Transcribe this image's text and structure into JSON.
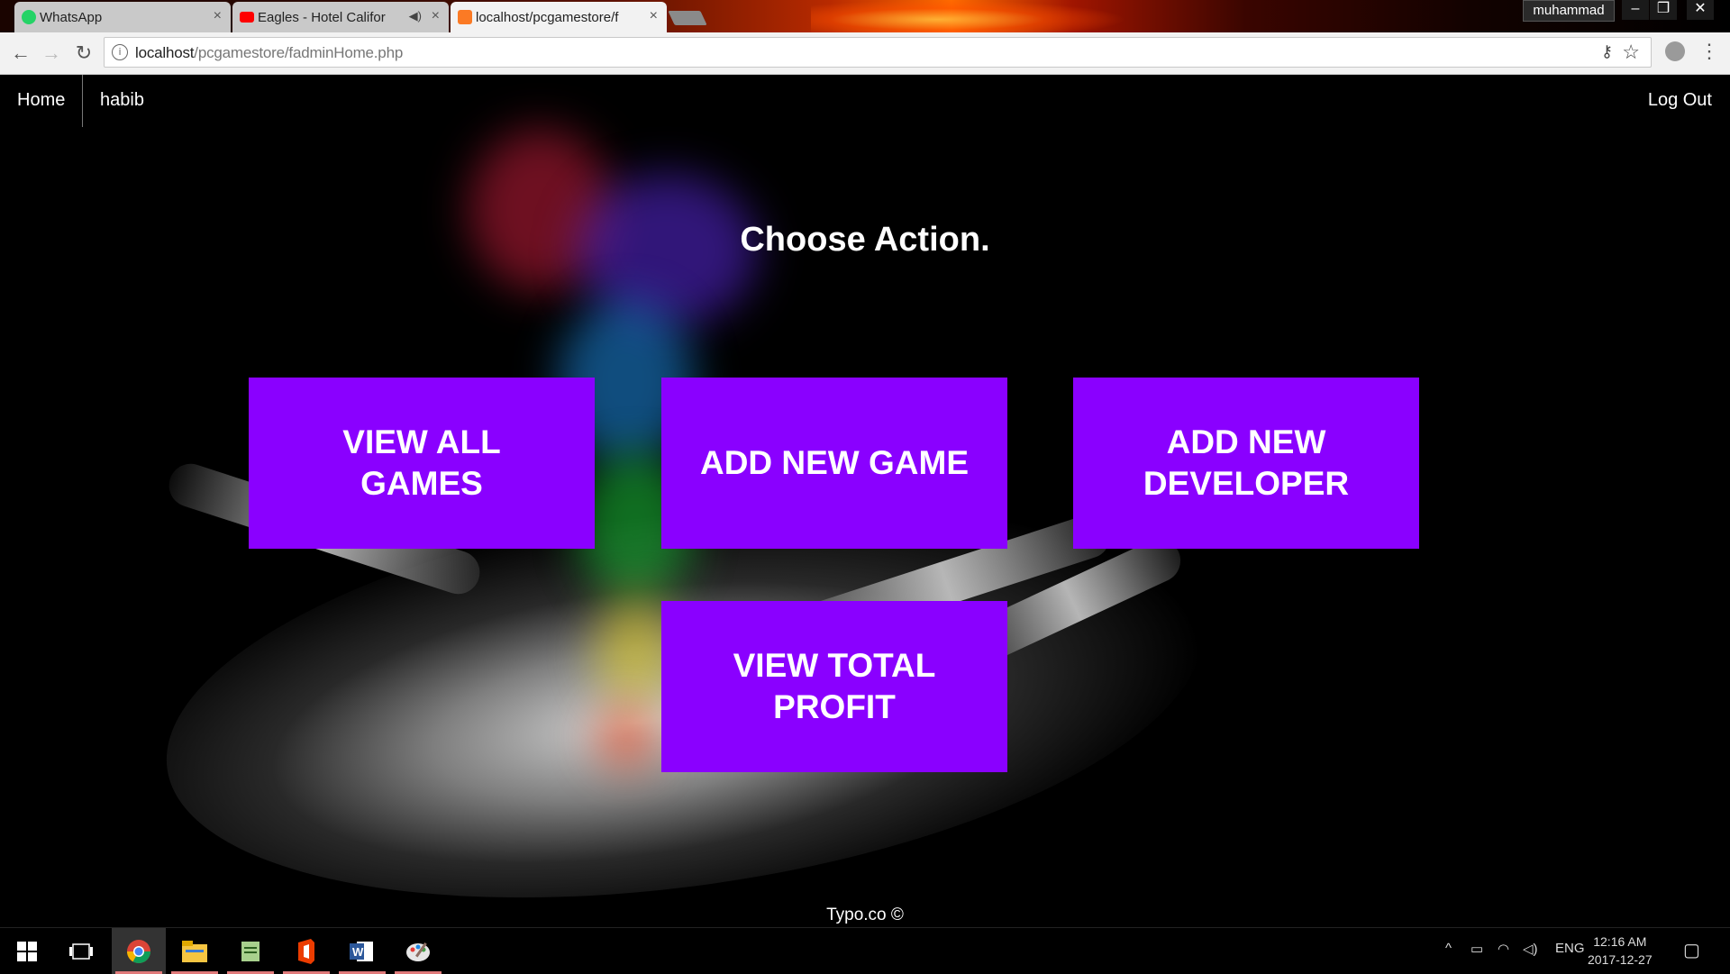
{
  "browser": {
    "tabs": [
      {
        "label": "WhatsApp",
        "active": false,
        "icon": "whatsapp-icon"
      },
      {
        "label": "Eagles - Hotel Califor",
        "active": false,
        "icon": "youtube-icon"
      },
      {
        "label": "localhost/pcgamestore/f",
        "active": true,
        "icon": "xampp-icon"
      }
    ],
    "user": "muhammad",
    "url_host": "localhost",
    "url_path": "/pcgamestore/fadminHome.php"
  },
  "nav": {
    "home": "Home",
    "user": "habib",
    "logout": "Log Out"
  },
  "main": {
    "title": "Choose Action.",
    "actions": [
      {
        "label": "VIEW ALL GAMES"
      },
      {
        "label": "ADD NEW GAME"
      },
      {
        "label": "ADD NEW DEVELOPER"
      },
      {
        "label": "VIEW TOTAL PROFIT"
      }
    ],
    "accent_color": "#8a00ff"
  },
  "footer": {
    "text": "Typo.co ©"
  },
  "taskbar": {
    "apps": [
      "chrome-icon",
      "file-explorer-icon",
      "notepad-icon",
      "office-icon",
      "word-icon",
      "paint-icon"
    ],
    "language": "ENG",
    "time": "12:16 AM",
    "date": "2017-12-27"
  }
}
